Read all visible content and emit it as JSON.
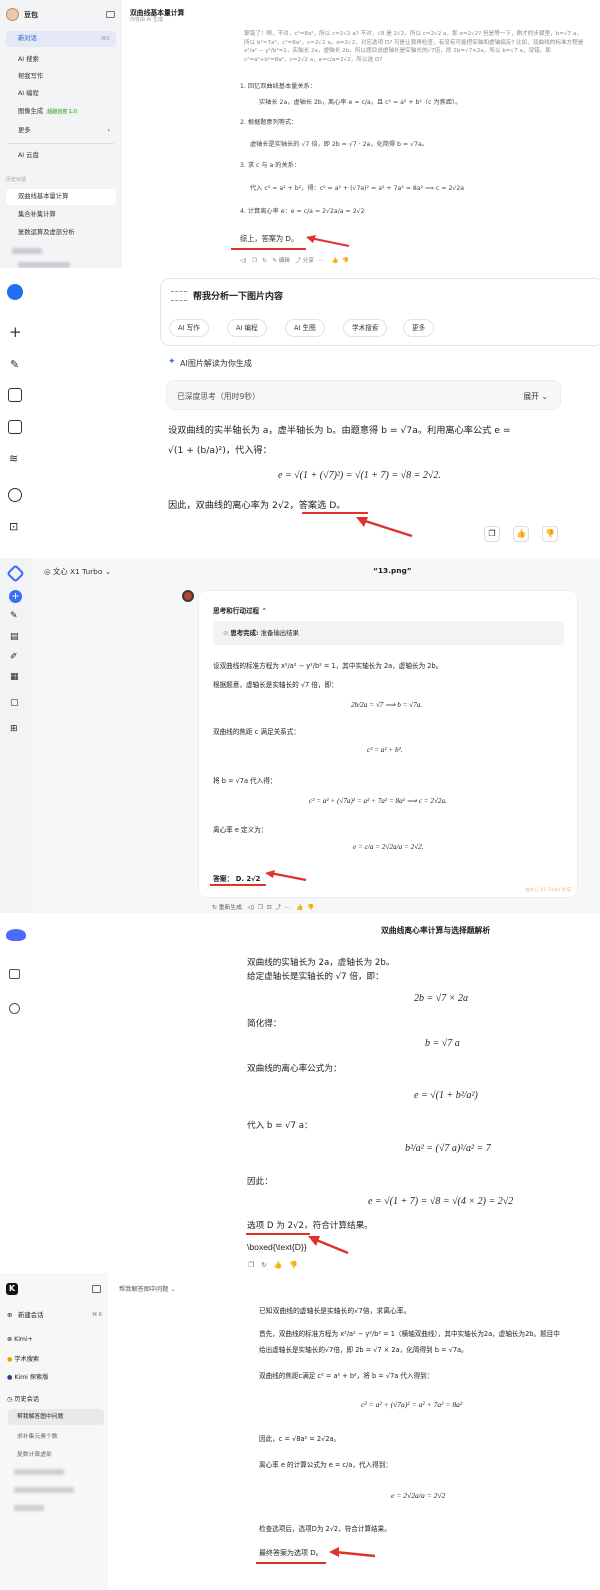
{
  "p1": {
    "user": "豆包",
    "title": "双曲线基本量计算",
    "subtitle": "内容由 AI 生成",
    "nav": [
      "新对话",
      "AI 搜索",
      "帮我写作",
      "AI 编程",
      "图像生成",
      "更多",
      "AI 云盘"
    ],
    "new_badge": "⌘K",
    "image_badge": "超越创意 1.0",
    "history_label": "历史对话",
    "history": [
      "双曲线基本量计算",
      "集合补集计算",
      "复数运算及虚部分析"
    ],
    "intro": "算错了！啊，不对，c²=8a²，所以 c=2√2 a? 不对，√8 是 2√2，所以 c=2√2 a，那 e=2√2? 但是等一下，刚才的步骤里，b=√7 a，所以 b²=7a²，c²=8a²，c=2√2 a，e=2√2，对应选项 D? 可是让我再检查，有没有可能把实轴和虚轴搞反? 比如，双曲线的标准方程是 x²/a² − y²/b²=1，实轴长 2a，虚轴长 2b，所以题目说虚轴长是实轴长的√7倍，即 2b=√7×2a，所以 b=√7 a，没错。那 c²=a²+b²=8a²，c=2√2 a，e=c/a=2√2，所以选 D?",
    "s1": "1. 回忆双曲线基本量关系：",
    "s1b": "实轴长 2a，虚轴长 2b，离心率 e = c/a，且 c² = a² + b²（c 为焦距）。",
    "s2": "2. 根据题意列等式：",
    "s2b": "虚轴长是实轴长的 √7 倍，即 2b = √7 · 2a，化简得 b = √7a。",
    "s3": "3. 求 c 与 a 的关系：",
    "s3b": "代入 c² = a² + b²，得：c² = a² + (√7a)² = a² + 7a² = 8a² ⟹ c = 2√2a",
    "s4": "4. 计算离心率 e：e = c/a = 2√2a/a = 2√2",
    "answer": "综上，答案为 D。",
    "actions": [
      "编辑",
      "分享"
    ]
  },
  "p2": {
    "prompt": "帮我分析一下图片内容",
    "chips": [
      "AI 写作",
      "AI 编程",
      "AI 生图",
      "学术搜索",
      "更多"
    ],
    "gen_label": "AI图片解读为你生成",
    "think": "已深度思考（用时9秒）",
    "expand": "展开",
    "line1": "设双曲线的实半轴长为 a，虚半轴长为 b。由题意得 b = √7a。利用离心率公式 e =",
    "line2": "√(1 + (b/a)²)，代入得：",
    "formula": "e = √(1 + (√7)²) = √(1 + 7) = √8 = 2√2.",
    "conclusion": "因此，双曲线的离心率为 2√2，",
    "answer": "答案选 D",
    "tail": "。"
  },
  "p3": {
    "model": "文心 X1 Turbo",
    "file": "“13.png”",
    "process": "思考和行动过程",
    "status_k": "思考完成:",
    "status_v": "准备输出结果",
    "l1": "设双曲线的标准方程为 x²/a² − y²/b² = 1，其中实轴长为 2a，虚轴长为 2b。",
    "l2": "根据题意，虚轴长是实轴长的 √7 倍，即：",
    "f1": "2b/2a = √7 ⟹ b = √7a.",
    "l3": "双曲线的焦距 c 满足关系式：",
    "f2": "c² = a² + b².",
    "l4": "将 b = √7a 代入得：",
    "f3": "c² = a² + (√7a)² = a² + 7a² = 8a² ⟹ c = 2√2a.",
    "l5": "离心率 e 定义为：",
    "f4": "e = c/a = 2√2a/a = 2√2.",
    "answer_k": "答案：",
    "answer_v": "D. 2√2",
    "regen": "重新生成",
    "watermark": "由文心 X1 Turbo 生成"
  },
  "p4": {
    "title": "双曲线离心率计算与选择题解析",
    "l1": "双曲线的实轴长为 2a，虚轴长为 2b。",
    "l2": "给定虚轴长是实轴长的 √7 倍，即：",
    "f1": "2b = √7 × 2a",
    "l3": "简化得：",
    "f2": "b = √7 a",
    "l4": "双曲线的离心率公式为：",
    "f3": "e = √(1 + b²/a²)",
    "l5": "代入 b = √7 a：",
    "f4": "b²/a² = (√7 a)²/a² = 7",
    "l6": "因此：",
    "f5": "e = √(1 + 7) = √8 = √(4 × 2) = 2√2",
    "answer": "选项 D 为 2√2，",
    "answer_tail": "符合计算结果。",
    "boxed": "\\boxed{\\text{D}}"
  },
  "p5": {
    "new_chat": "新建会话",
    "shortcut": "⌘ K",
    "nav": [
      "Kimi+",
      "学术搜索",
      "Kimi 探索版"
    ],
    "history_label": "历史会话",
    "history": [
      "帮我解答图中问题",
      "求补集元素个数",
      "复数计算虚部"
    ],
    "header": "帮我解答图中问题",
    "q": "已知双曲线的虚轴长是实轴长的√7倍，求离心率。",
    "l1": "首先，双曲线的标准方程为 x²/a² − y²/b² = 1（横轴双曲线），其中实轴长为2a，虚轴长为2b。题目中",
    "l1b": "给出虚轴长是实轴长的√7倍，即 2b = √7 × 2a，化简得到 b = √7a。",
    "l2": "双曲线的焦距c满足 c² = a² + b²，将 b = √7a 代入得到：",
    "f1": "c² = a² + (√7a)² = a² + 7a² = 8a²",
    "l3": "因此，c = √8a² = 2√2a。",
    "l4": "离心率 e 的计算公式为 e = c/a，代入得到：",
    "f2": "e = 2√2a/a = 2√2",
    "l5": "检查选项后，选项D为 2√2，符合计算结果。",
    "answer": "最终答案为选项 D。"
  }
}
